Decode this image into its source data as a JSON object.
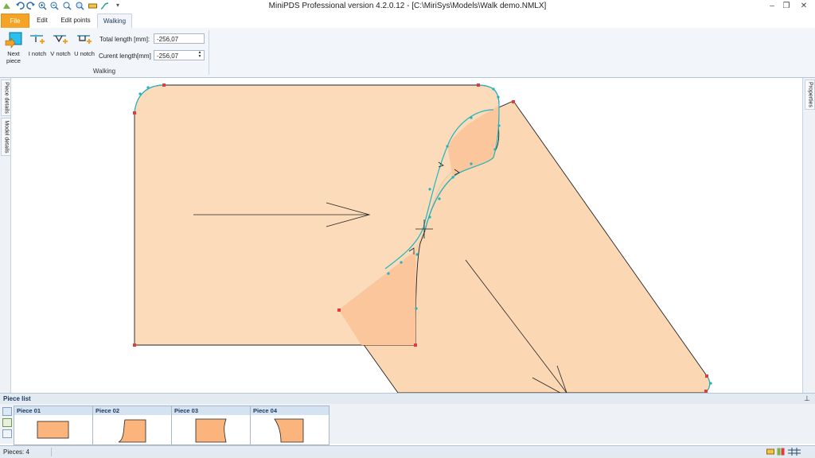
{
  "window": {
    "title": "MiniPDS Professional version 4.2.0.12 - [C:\\MiriSys\\Models\\Walk demo.NMLX]",
    "minimize": "–",
    "restore": "❐",
    "close": "✕"
  },
  "ribbon": {
    "tabs": [
      {
        "label": "File"
      },
      {
        "label": "Edit"
      },
      {
        "label": "Edit points"
      },
      {
        "label": "Walking"
      }
    ],
    "active_tab": "Walking",
    "buttons": [
      {
        "label": "Next piece",
        "icon": "next-piece-icon"
      },
      {
        "label": "I notch",
        "icon": "i-notch-icon"
      },
      {
        "label": "V notch",
        "icon": "v-notch-icon"
      },
      {
        "label": "U notch",
        "icon": "u-notch-icon"
      }
    ],
    "total_length_label": "Total length [mm]:",
    "total_length_value": "-256,07",
    "current_length_label": "Curent length[mm]",
    "current_length_value": "-256,07",
    "group_label": "Walking"
  },
  "side_tabs": {
    "left": [
      "Piece details",
      "Model details"
    ],
    "right": [
      "Properties"
    ]
  },
  "piece_list": {
    "title": "Piece list",
    "pieces": [
      {
        "label": "Piece 01"
      },
      {
        "label": "Piece 02"
      },
      {
        "label": "Piece 03"
      },
      {
        "label": "Piece 04"
      }
    ]
  },
  "status": {
    "pieces_text": "Pieces: 4"
  },
  "colors": {
    "piece_fill": "#fcd7b4",
    "piece_overlap": "#fbc69c",
    "outline_teal": "#1fb5bd",
    "point_red": "#e03c3c",
    "file_tab": "#f4a324"
  }
}
